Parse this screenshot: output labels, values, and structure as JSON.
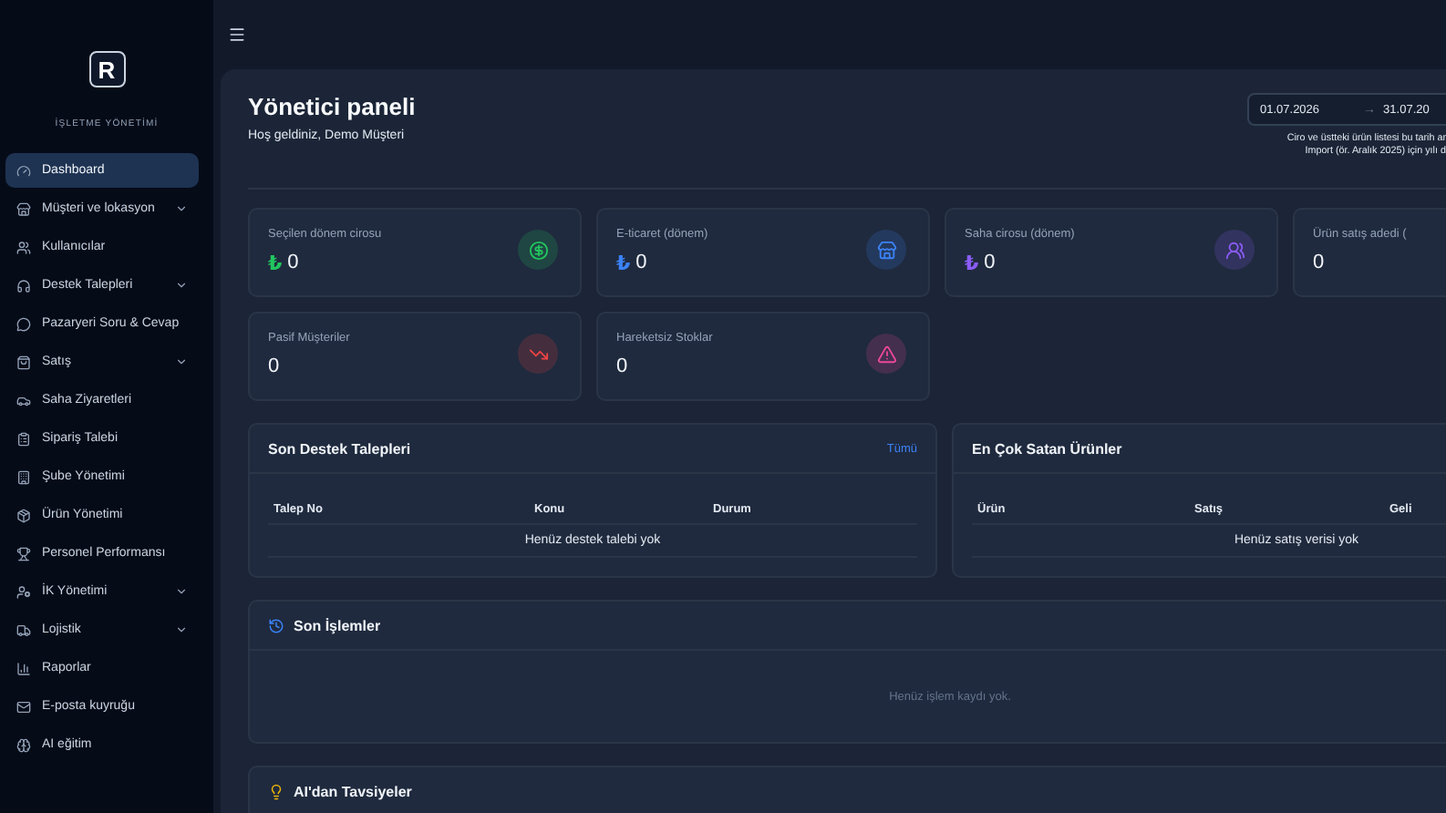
{
  "sidebar": {
    "logo": "R",
    "subtitle": "İŞLETME YÖNETİMİ",
    "items": [
      {
        "label": "Dashboard",
        "selected": true,
        "expandable": false
      },
      {
        "label": "Müşteri ve lokasyon",
        "selected": false,
        "expandable": true
      },
      {
        "label": "Kullanıcılar",
        "selected": false,
        "expandable": false
      },
      {
        "label": "Destek Talepleri",
        "selected": false,
        "expandable": true
      },
      {
        "label": "Pazaryeri Soru & Cevap",
        "selected": false,
        "expandable": false
      },
      {
        "label": "Satış",
        "selected": false,
        "expandable": true
      },
      {
        "label": "Saha Ziyaretleri",
        "selected": false,
        "expandable": false
      },
      {
        "label": "Sipariş Talebi",
        "selected": false,
        "expandable": false
      },
      {
        "label": "Şube Yönetimi",
        "selected": false,
        "expandable": false
      },
      {
        "label": "Ürün Yönetimi",
        "selected": false,
        "expandable": false
      },
      {
        "label": "Personel Performansı",
        "selected": false,
        "expandable": false
      },
      {
        "label": "İK Yönetimi",
        "selected": false,
        "expandable": true
      },
      {
        "label": "Lojistik",
        "selected": false,
        "expandable": true
      },
      {
        "label": "Raporlar",
        "selected": false,
        "expandable": false
      },
      {
        "label": "E-posta kuyruğu",
        "selected": false,
        "expandable": false
      },
      {
        "label": "AI eğitim",
        "selected": false,
        "expandable": false
      }
    ]
  },
  "header": {
    "title": "Yönetici paneli",
    "subtitle": "Hoş geldiniz, Demo Müşteri",
    "date_from": "01.07.2026",
    "date_separator": "→",
    "date_to": "31.07.20",
    "caption_lines": [
      "Ciro ve üstteki ürün listesi bu tarih ar",
      "Import (ör. Aralık 2025) için yılı d"
    ]
  },
  "stats": [
    {
      "label": "Seçilen dönem cirosu",
      "currency": "₺",
      "value": "0",
      "color": "#22c55e"
    },
    {
      "label": "E-ticaret (dönem)",
      "currency": "₺",
      "value": "0",
      "color": "#3b82f6"
    },
    {
      "label": "Saha cirosu (dönem)",
      "currency": "₺",
      "value": "0",
      "color": "#8b5cf6"
    },
    {
      "label": "Ürün satış adedi (",
      "value": "0"
    },
    {
      "label": "Pasif Müşteriler",
      "value": "0",
      "color": "#ef4444"
    },
    {
      "label": "Hareketsiz Stoklar",
      "value": "0",
      "color": "#ec4899"
    }
  ],
  "support": {
    "title": "Son Destek Talepleri",
    "link": "Tümü",
    "columns": [
      "Talep No",
      "Konu",
      "Durum"
    ],
    "empty": "Henüz destek talebi yok"
  },
  "top_products": {
    "title": "En Çok Satan Ürünler",
    "columns": [
      "Ürün",
      "Satış",
      "Geli"
    ],
    "empty": "Henüz satış verisi yok"
  },
  "recent": {
    "title": "Son İşlemler",
    "empty": "Henüz işlem kaydı yok."
  },
  "ai": {
    "title": "AI'dan Tavsiyeler"
  }
}
